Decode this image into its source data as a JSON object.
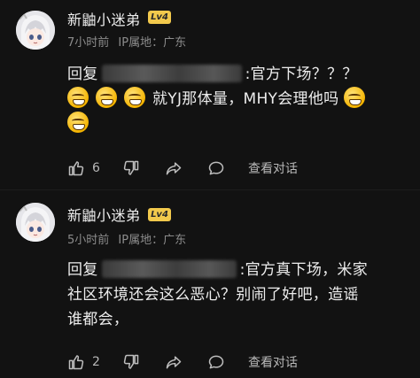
{
  "comments": [
    {
      "username": "新鼬小迷弟",
      "level": "Lv4",
      "time": "7小时前",
      "ip_label": "IP属地：广东",
      "reply_prefix": "回复",
      "text_line1_suffix": ":官方下场？？？",
      "text_line2": "就YJ那体量，MHY会理他吗",
      "likes": "6",
      "view_replies": "查看对话"
    },
    {
      "username": "新鼬小迷弟",
      "level": "Lv4",
      "time": "5小时前",
      "ip_label": "IP属地：广东",
      "reply_prefix": "回复",
      "text_line1_suffix": ":官方真下场，米家",
      "text_line2": "社区环境还会这么恶心？别闹了好吧，造谣",
      "text_line3": "谁都会，",
      "likes": "2",
      "view_replies": "查看对话"
    }
  ],
  "icons": {
    "like": "thumbs-up-icon",
    "dislike": "thumbs-down-icon",
    "share": "share-icon",
    "comment": "comment-icon",
    "emoji": "grinning-emoji-icon"
  },
  "colors": {
    "background": "#121212",
    "text": "#ededed",
    "meta": "#8c8c8c",
    "level_badge": "#f2c94c"
  }
}
